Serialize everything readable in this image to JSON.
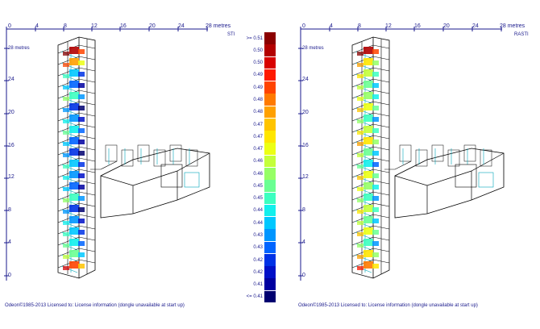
{
  "left_panel": {
    "x_ticks": [
      "0",
      "4",
      "8",
      "12",
      "16",
      "20",
      "24",
      "28 metres"
    ],
    "y_ticks": [
      "28 metres",
      "24",
      "20",
      "16",
      "12",
      "8",
      "4",
      "0"
    ],
    "parameter": "STI",
    "footer": "Odeon©1985-2013    Licensed to: License information (dongle unavailable at start up)"
  },
  "right_panel": {
    "x_ticks": [
      "0",
      "4",
      "8",
      "12",
      "16",
      "20",
      "24",
      "28 metres"
    ],
    "y_ticks": [
      "28 metres",
      "24",
      "20",
      "16",
      "12",
      "8",
      "4",
      "0"
    ],
    "parameter": "RASTI",
    "footer": "Odeon©1985-2013    Licensed to: License information (dongle unavailable at start up)"
  },
  "legend": {
    "labels": [
      ">= 0.51",
      "0.50",
      "0.50",
      "0.49",
      "0.49",
      "0.48",
      "0.48",
      "0.47",
      "0.47",
      "0.47",
      "0.46",
      "0.46",
      "0.45",
      "0.45",
      "0.44",
      "0.44",
      "0.43",
      "0.43",
      "0.42",
      "0.42",
      "0.41",
      "<= 0.41"
    ],
    "colors": [
      "#8b0000",
      "#b30000",
      "#d80000",
      "#ff1a00",
      "#ff4400",
      "#ff7a00",
      "#ffa000",
      "#ffc400",
      "#ffe600",
      "#ecff14",
      "#c4ff3a",
      "#96ff66",
      "#6aff92",
      "#3cffc0",
      "#12f0ec",
      "#00c8ff",
      "#0096ff",
      "#0064ff",
      "#0032e6",
      "#0010c8",
      "#0000a0",
      "#000070"
    ]
  },
  "colors": {
    "axis": "#1a1a8c",
    "wire": "#000000"
  }
}
